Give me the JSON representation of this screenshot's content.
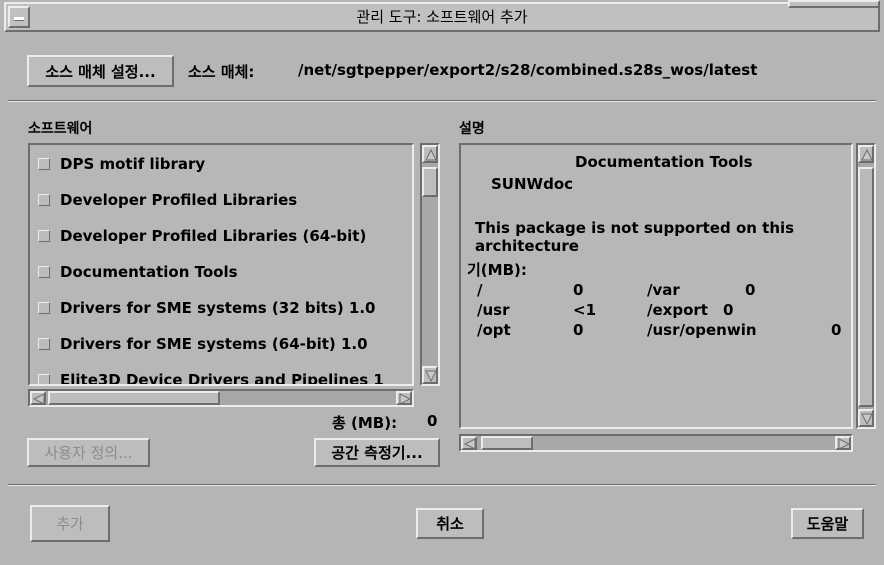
{
  "window": {
    "title": "관리 도구: 소프트웨어 추가"
  },
  "source": {
    "button_label": "소스 매체 설정...",
    "label": "소스 매체:",
    "path": "/net/sgtpepper/export2/s28/combined.s28s_wos/latest"
  },
  "software": {
    "heading": "소프트웨어",
    "items": [
      {
        "label": "DPS motif library",
        "checked": false
      },
      {
        "label": "Developer Profiled Libraries",
        "checked": false
      },
      {
        "label": "Developer Profiled Libraries (64-bit)",
        "checked": false
      },
      {
        "label": "Documentation Tools",
        "checked": false
      },
      {
        "label": "Drivers for SME systems (32 bits) 1.0",
        "checked": false
      },
      {
        "label": "Drivers for SME systems (64-bit) 1.0",
        "checked": false
      },
      {
        "label": "Elite3D Device Drivers and Pipelines 1",
        "checked": false
      }
    ],
    "total_label": "총 (MB):",
    "total_value": "0",
    "custom_button": "사용자 정의...",
    "space_button": "공간 측정기..."
  },
  "description": {
    "heading": "설명",
    "title": "Documentation Tools",
    "package": "SUNWdoc",
    "note_line1": "This package is not supported on this",
    "note_line2": "architecture",
    "size_header": "기(MB):",
    "sizes": [
      {
        "fs1": "/",
        "v1": "0",
        "fs2": "/var",
        "v2": "0"
      },
      {
        "fs1": "/usr",
        "v1": "<1",
        "fs2": "/export",
        "v2": "0"
      },
      {
        "fs1": "/opt",
        "v1": "0",
        "fs2": "/usr/openwin",
        "v2": "0"
      }
    ]
  },
  "footer": {
    "add_button": "추가",
    "cancel_button": "취소",
    "help_button": "도움말"
  },
  "colors": {
    "background": "#b5b5b5",
    "disabled_text": "#8c8c8c"
  }
}
